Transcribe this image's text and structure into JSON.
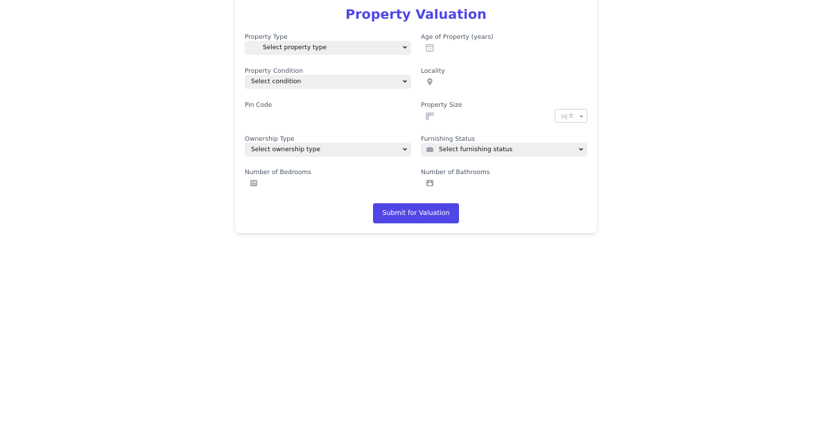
{
  "form": {
    "title": "Property Valuation",
    "submit_label": "Submit for Valuation",
    "accent_color": "#4f46e5"
  },
  "fields": {
    "property_type": {
      "label": "Property Type",
      "value": "Select property type"
    },
    "age": {
      "label": "Age of Property (years)",
      "value": "",
      "icon": "calendar-icon"
    },
    "condition": {
      "label": "Property Condition",
      "value": "Select condition"
    },
    "locality": {
      "label": "Locality",
      "value": "",
      "icon": "map-pin-icon"
    },
    "pin_code": {
      "label": "Pin Code",
      "value": ""
    },
    "size": {
      "label": "Property Size",
      "value": "",
      "icon": "ruler-icon",
      "unit": "sq ft"
    },
    "ownership": {
      "label": "Ownership Type",
      "value": "Select ownership type"
    },
    "furnishing": {
      "label": "Furnishing Status",
      "value": "Select furnishing status",
      "icon": "couch-icon"
    },
    "bedrooms": {
      "label": "Number of Bedrooms",
      "value": "",
      "icon": "bed-icon"
    },
    "bathrooms": {
      "label": "Number of Bathrooms",
      "value": "",
      "icon": "bath-icon"
    }
  }
}
